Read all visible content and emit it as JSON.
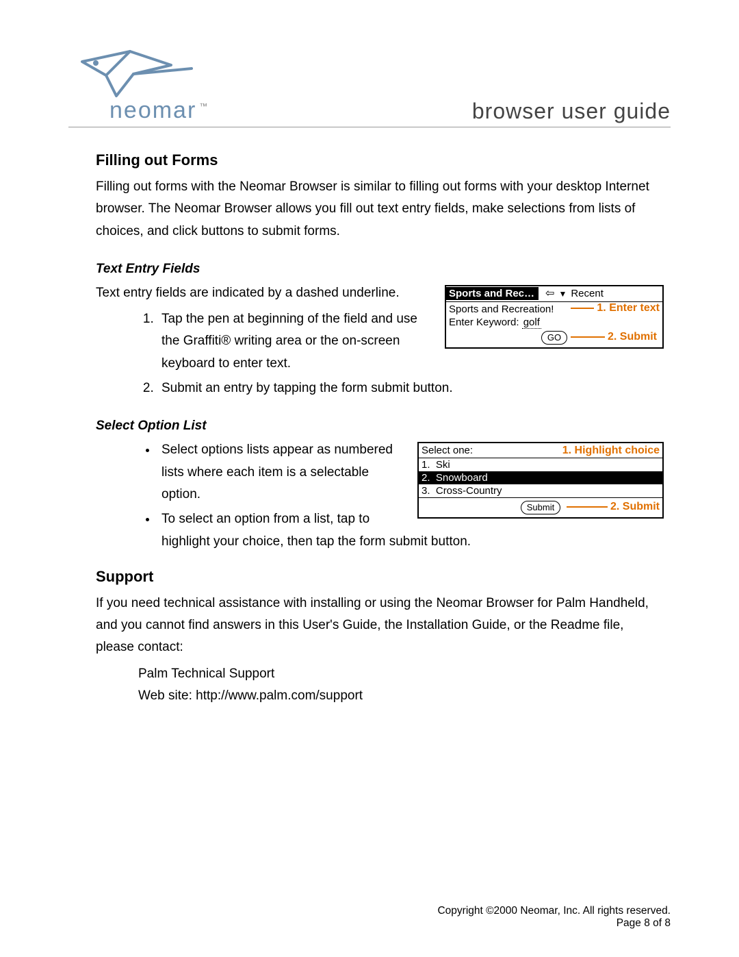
{
  "header": {
    "brand": "neomar",
    "tm": "™",
    "doc_title": "browser user guide"
  },
  "sections": {
    "forms": {
      "heading": "Filling out Forms",
      "intro": "Filling out forms with the Neomar Browser is similar to filling out forms with your desktop Internet browser. The Neomar Browser allows you fill out text entry fields, make selections from lists of choices, and click buttons to submit forms.",
      "text_entry": {
        "heading": "Text Entry Fields",
        "lead": "Text entry fields are indicated by a dashed underline.",
        "steps": [
          "Tap the pen at beginning of the field and use the Graffiti® writing area or the on-screen keyboard to enter text.",
          "Submit an entry by tapping the form submit button."
        ],
        "figure": {
          "titlebar_left": "Sports and Rec…",
          "titlebar_recent": "Recent",
          "line1": "Sports and Recreation!",
          "line2_label": "Enter Keyword: ",
          "line2_value": "golf",
          "go_label": "GO",
          "ann1": "1. Enter text",
          "ann2": "2. Submit"
        }
      },
      "select": {
        "heading": "Select Option List",
        "bullets": [
          "Select options lists appear as numbered lists where each item is a selectable option.",
          "To select an option from a list, tap to highlight your choice, then tap the form submit button."
        ],
        "figure": {
          "prompt": "Select one:",
          "items": [
            "Ski",
            "Snowboard",
            "Cross-Country"
          ],
          "highlighted_index": 1,
          "submit_label": "Submit",
          "ann1": "1. Highlight choice",
          "ann2": "2. Submit"
        }
      }
    },
    "support": {
      "heading": "Support",
      "body": "If you need technical assistance with installing or using the Neomar Browser for Palm Handheld, and you cannot find answers in this User's Guide, the Installation Guide, or the Readme file, please contact:",
      "contact_name": "Palm Technical Support",
      "contact_site": "Web site: http://www.palm.com/support"
    }
  },
  "footer": {
    "copyright": "Copyright ©2000 Neomar, Inc. All rights reserved.",
    "page": "Page 8 of 8"
  }
}
